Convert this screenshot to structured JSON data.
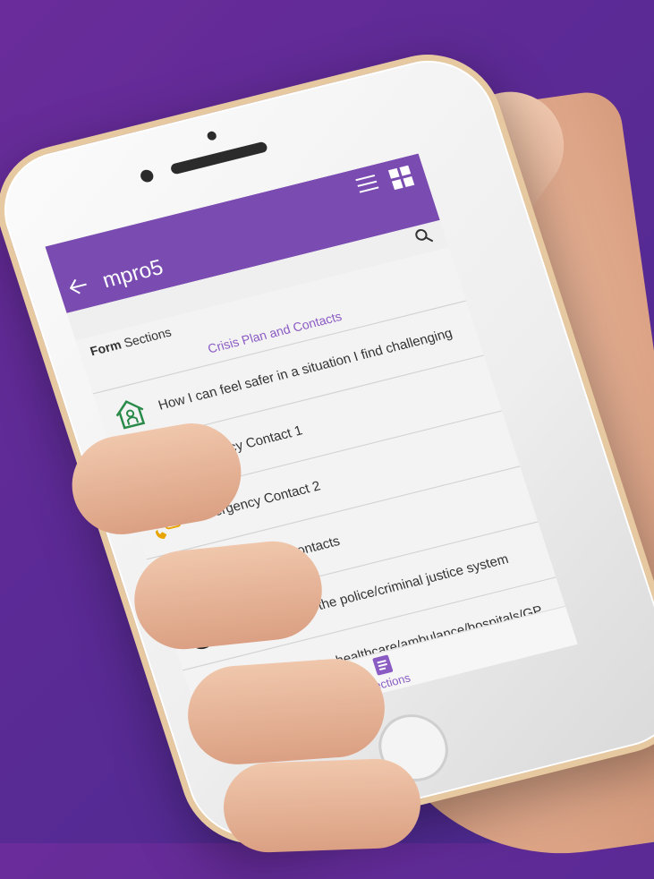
{
  "app": {
    "title": "mpro5"
  },
  "breadcrumb": {
    "bold": "Form",
    "rest": " Sections"
  },
  "section": {
    "title": "Crisis Plan and Contacts"
  },
  "items": [
    {
      "label": "How I can feel safer in a situation I find challenging",
      "icon": "house-person-icon"
    },
    {
      "label": "Emergency Contact 1",
      "icon": "phone-chat-icon"
    },
    {
      "label": "Emergency Contact 2",
      "icon": "phone-chat-icon"
    },
    {
      "label": "Professional Contacts",
      "icon": "person-circle-icon"
    },
    {
      "label": "Information for the police/criminal justice system",
      "icon": "info-badge-icon"
    },
    {
      "label": "Information for healthcare/ambulance/hospitals/GP",
      "icon": "info-medical-icon"
    }
  ],
  "bottom_nav": {
    "label": "Sections",
    "icon": "document-icon"
  },
  "colors": {
    "primary": "#7a4cb1",
    "accent": "#8b5bc4",
    "background_gradient_start": "#6a2c9a",
    "background_gradient_end": "#4a2a8f"
  }
}
